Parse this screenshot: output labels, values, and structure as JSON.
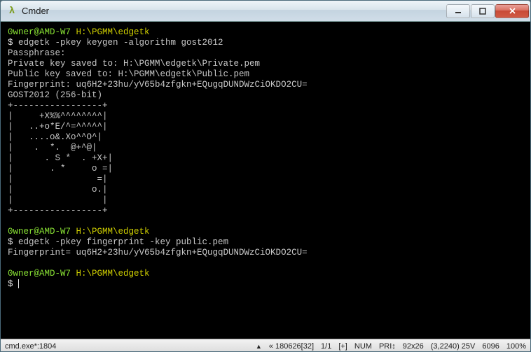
{
  "window": {
    "title": "Cmder",
    "icon": "λ"
  },
  "terminal": {
    "prompt1_user": "0wner@AMD-W7",
    "prompt1_path": "H:\\PGMM\\edgetk",
    "cmd1": "edgetk -pkey keygen -algorithm gost2012",
    "out1_l1": "Passphrase:",
    "out1_l2": "Private key saved to: H:\\PGMM\\edgetk\\Private.pem",
    "out1_l3": "Public key saved to: H:\\PGMM\\edgetk\\Public.pem",
    "out1_l4": "Fingerprint: uq6H2+23hu/yV65b4zfgkn+EQugqDUNDWzCiOKDO2CU=",
    "out1_l5": "GOST2012 (256-bit)",
    "art_l01": "+-----------------+",
    "art_l02": "|     +X%%^^^^^^^^|",
    "art_l03": "|   ..+o*E/^=^^^^^|",
    "art_l04": "|   ....o&.Xo^^O^|",
    "art_l05": "|    .  *.  @+^@|",
    "art_l06": "|      . S *  . +X+|",
    "art_l07": "|       . *     o =|",
    "art_l08": "|                =|",
    "art_l09": "|               o.|",
    "art_l10": "|                 |",
    "art_l11": "+-----------------+",
    "prompt2_user": "0wner@AMD-W7",
    "prompt2_path": "H:\\PGMM\\edgetk",
    "cmd2": "edgetk -pkey fingerprint -key public.pem",
    "out2_l1": "Fingerprint= uq6H2+23hu/yV65b4zfgkn+EQugqDUNDWzCiOKDO2CU=",
    "prompt3_user": "0wner@AMD-W7",
    "prompt3_path": "H:\\PGMM\\edgetk",
    "dollar": "$ "
  },
  "status": {
    "tab": "cmd.exe*:1804",
    "seg1": "« 180626[32]",
    "seg2": "1/1",
    "seg3": "[+]",
    "seg4": "NUM",
    "seg5": "PRI↕",
    "seg6": "92x26",
    "seg7": "(3,2240) 25V",
    "seg8": "6096",
    "seg9": "100%"
  }
}
